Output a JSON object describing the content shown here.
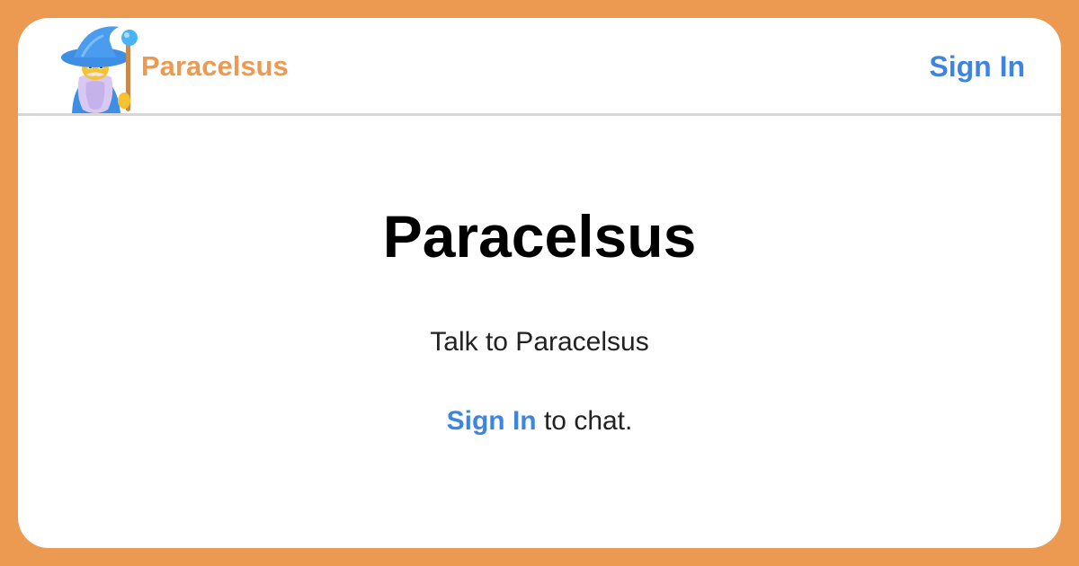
{
  "header": {
    "brand_name": "Paracelsus",
    "sign_in_label": "Sign In",
    "logo_icon": "wizard-icon"
  },
  "main": {
    "title": "Paracelsus",
    "subtitle": "Talk to Paracelsus",
    "sign_in_link": "Sign In",
    "sign_in_suffix": " to chat."
  },
  "colors": {
    "background": "#EC9A52",
    "brand": "#EC9A52",
    "link": "#3D85E0",
    "card": "#ffffff"
  }
}
